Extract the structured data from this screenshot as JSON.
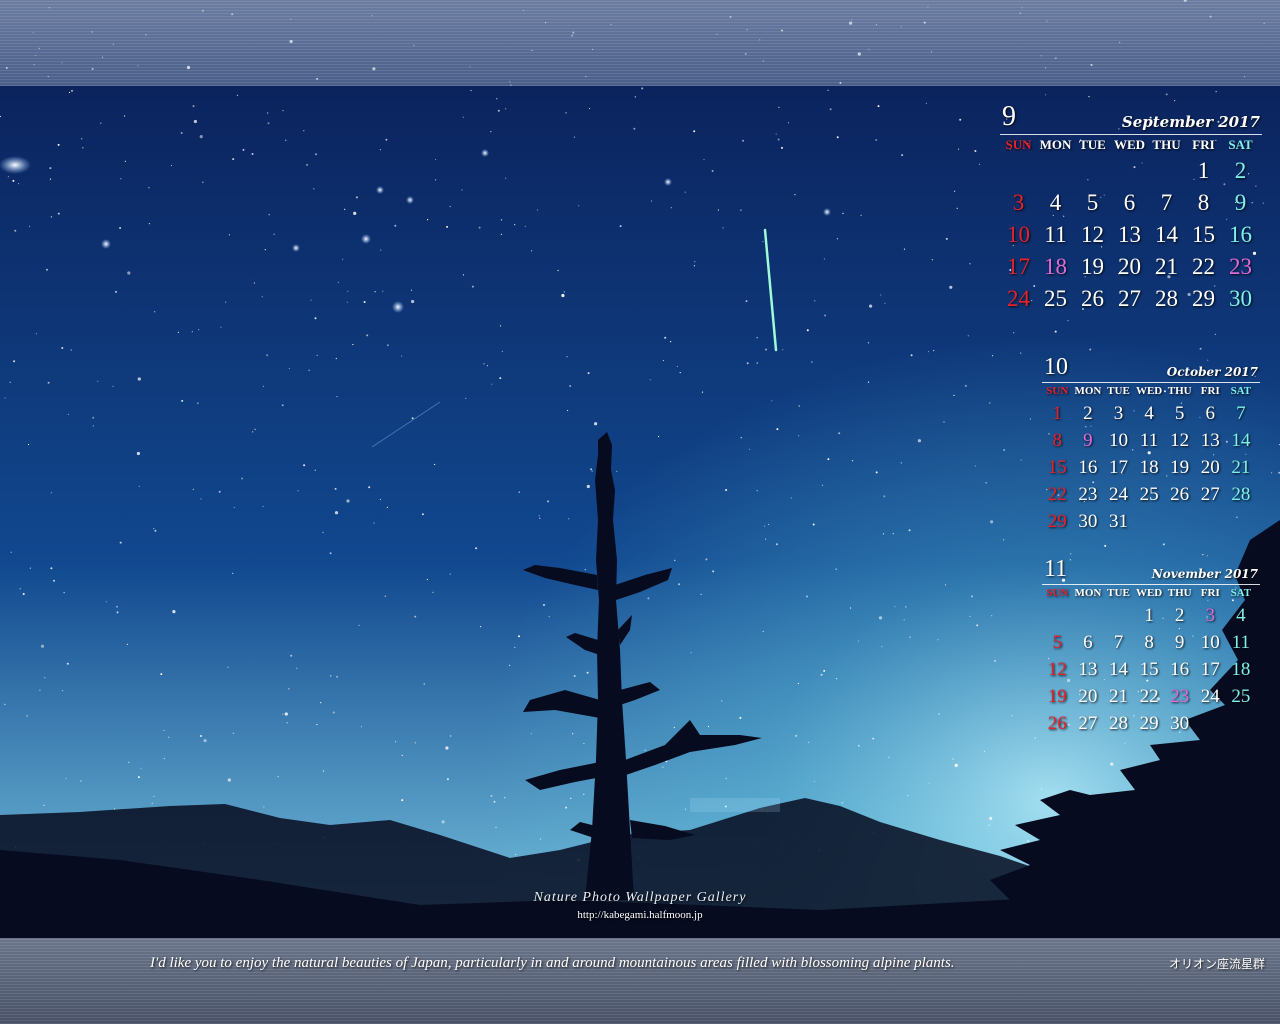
{
  "scene": {
    "sky_top_color": "#0a1d55",
    "sky_mid_color": "#11488f",
    "sky_glow_color": "#8fe0f0",
    "silhouette_color": "#060b1f",
    "meteor_color": "#9dfbd5"
  },
  "calendars": [
    {
      "id": "cal-sep",
      "month_number": "9",
      "month_name": "September 2017",
      "weekdays": [
        "SUN",
        "MON",
        "TUE",
        "WED",
        "THU",
        "FRI",
        "SAT"
      ],
      "weeks": [
        [
          {
            "d": "",
            "t": "wk"
          },
          {
            "d": "",
            "t": "wk"
          },
          {
            "d": "",
            "t": "wk"
          },
          {
            "d": "",
            "t": "wk"
          },
          {
            "d": "",
            "t": "wk"
          },
          {
            "d": "1",
            "t": "wk"
          },
          {
            "d": "2",
            "t": "sat"
          }
        ],
        [
          {
            "d": "3",
            "t": "sun"
          },
          {
            "d": "4",
            "t": "wk"
          },
          {
            "d": "5",
            "t": "wk"
          },
          {
            "d": "6",
            "t": "wk"
          },
          {
            "d": "7",
            "t": "wk"
          },
          {
            "d": "8",
            "t": "wk"
          },
          {
            "d": "9",
            "t": "sat"
          }
        ],
        [
          {
            "d": "10",
            "t": "sun"
          },
          {
            "d": "11",
            "t": "wk"
          },
          {
            "d": "12",
            "t": "wk"
          },
          {
            "d": "13",
            "t": "wk"
          },
          {
            "d": "14",
            "t": "wk"
          },
          {
            "d": "15",
            "t": "wk"
          },
          {
            "d": "16",
            "t": "sat"
          }
        ],
        [
          {
            "d": "17",
            "t": "sun"
          },
          {
            "d": "18",
            "t": "hol"
          },
          {
            "d": "19",
            "t": "wk"
          },
          {
            "d": "20",
            "t": "wk"
          },
          {
            "d": "21",
            "t": "wk"
          },
          {
            "d": "22",
            "t": "wk"
          },
          {
            "d": "23",
            "t": "hol"
          }
        ],
        [
          {
            "d": "24",
            "t": "sun"
          },
          {
            "d": "25",
            "t": "wk"
          },
          {
            "d": "26",
            "t": "wk"
          },
          {
            "d": "27",
            "t": "wk"
          },
          {
            "d": "28",
            "t": "wk"
          },
          {
            "d": "29",
            "t": "wk"
          },
          {
            "d": "30",
            "t": "sat"
          }
        ]
      ]
    },
    {
      "id": "cal-oct",
      "month_number": "10",
      "month_name": "October 2017",
      "weekdays": [
        "SUN",
        "MON",
        "TUE",
        "WED",
        "THU",
        "FRI",
        "SAT"
      ],
      "weeks": [
        [
          {
            "d": "1",
            "t": "sun"
          },
          {
            "d": "2",
            "t": "wk"
          },
          {
            "d": "3",
            "t": "wk"
          },
          {
            "d": "4",
            "t": "wk"
          },
          {
            "d": "5",
            "t": "wk"
          },
          {
            "d": "6",
            "t": "wk"
          },
          {
            "d": "7",
            "t": "sat"
          }
        ],
        [
          {
            "d": "8",
            "t": "sun"
          },
          {
            "d": "9",
            "t": "hol"
          },
          {
            "d": "10",
            "t": "wk"
          },
          {
            "d": "11",
            "t": "wk"
          },
          {
            "d": "12",
            "t": "wk"
          },
          {
            "d": "13",
            "t": "wk"
          },
          {
            "d": "14",
            "t": "sat"
          }
        ],
        [
          {
            "d": "15",
            "t": "sun"
          },
          {
            "d": "16",
            "t": "wk"
          },
          {
            "d": "17",
            "t": "wk"
          },
          {
            "d": "18",
            "t": "wk"
          },
          {
            "d": "19",
            "t": "wk"
          },
          {
            "d": "20",
            "t": "wk"
          },
          {
            "d": "21",
            "t": "sat"
          }
        ],
        [
          {
            "d": "22",
            "t": "sun"
          },
          {
            "d": "23",
            "t": "wk"
          },
          {
            "d": "24",
            "t": "wk"
          },
          {
            "d": "25",
            "t": "wk"
          },
          {
            "d": "26",
            "t": "wk"
          },
          {
            "d": "27",
            "t": "wk"
          },
          {
            "d": "28",
            "t": "sat"
          }
        ],
        [
          {
            "d": "29",
            "t": "sun"
          },
          {
            "d": "30",
            "t": "wk"
          },
          {
            "d": "31",
            "t": "wk"
          },
          {
            "d": "",
            "t": "wk"
          },
          {
            "d": "",
            "t": "wk"
          },
          {
            "d": "",
            "t": "wk"
          },
          {
            "d": "",
            "t": "wk"
          }
        ]
      ]
    },
    {
      "id": "cal-nov",
      "month_number": "11",
      "month_name": "November 2017",
      "weekdays": [
        "SUN",
        "MON",
        "TUE",
        "WED",
        "THU",
        "FRI",
        "SAT"
      ],
      "weeks": [
        [
          {
            "d": "",
            "t": "wk"
          },
          {
            "d": "",
            "t": "wk"
          },
          {
            "d": "",
            "t": "wk"
          },
          {
            "d": "1",
            "t": "wk"
          },
          {
            "d": "2",
            "t": "wk"
          },
          {
            "d": "3",
            "t": "hol"
          },
          {
            "d": "4",
            "t": "sat"
          }
        ],
        [
          {
            "d": "5",
            "t": "sun"
          },
          {
            "d": "6",
            "t": "wk"
          },
          {
            "d": "7",
            "t": "wk"
          },
          {
            "d": "8",
            "t": "wk"
          },
          {
            "d": "9",
            "t": "wk"
          },
          {
            "d": "10",
            "t": "wk"
          },
          {
            "d": "11",
            "t": "sat"
          }
        ],
        [
          {
            "d": "12",
            "t": "sun"
          },
          {
            "d": "13",
            "t": "wk"
          },
          {
            "d": "14",
            "t": "wk"
          },
          {
            "d": "15",
            "t": "wk"
          },
          {
            "d": "16",
            "t": "wk"
          },
          {
            "d": "17",
            "t": "wk"
          },
          {
            "d": "18",
            "t": "sat"
          }
        ],
        [
          {
            "d": "19",
            "t": "sun"
          },
          {
            "d": "20",
            "t": "wk"
          },
          {
            "d": "21",
            "t": "wk"
          },
          {
            "d": "22",
            "t": "wk"
          },
          {
            "d": "23",
            "t": "hol"
          },
          {
            "d": "24",
            "t": "wk"
          },
          {
            "d": "25",
            "t": "sat"
          }
        ],
        [
          {
            "d": "26",
            "t": "sun"
          },
          {
            "d": "27",
            "t": "wk"
          },
          {
            "d": "28",
            "t": "wk"
          },
          {
            "d": "29",
            "t": "wk"
          },
          {
            "d": "30",
            "t": "wk"
          },
          {
            "d": "",
            "t": "wk"
          },
          {
            "d": "",
            "t": "wk"
          }
        ]
      ]
    }
  ],
  "footer": {
    "gallery_title": "Nature Photo Wallpaper Gallery",
    "gallery_url": "http://kabegami.halfmoon.jp",
    "tagline": "I'd like you to enjoy the natural beauties of Japan, particularly in and around mountainous areas filled with blossoming alpine plants.",
    "photo_title": "オリオン座流星群"
  }
}
